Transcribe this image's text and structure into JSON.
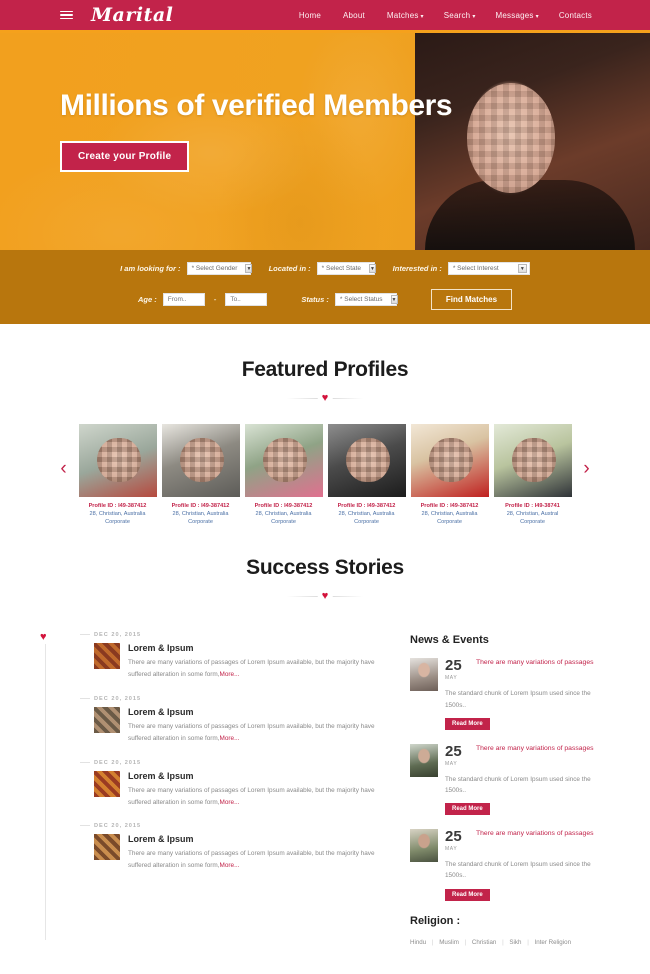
{
  "theme": {
    "brand_red": "#C2234A",
    "hero_orange": "#F2A01E",
    "filter_amber": "#B8760D",
    "heart_red": "#D3133C",
    "link_blue": "#4a6fa5"
  },
  "nav": {
    "brand": "Marital",
    "menu": [
      {
        "label": "Home",
        "caret": ""
      },
      {
        "label": "About",
        "caret": ""
      },
      {
        "label": "Matches",
        "caret": "▾"
      },
      {
        "label": "Search",
        "caret": "▾"
      },
      {
        "label": "Messages",
        "caret": "▾"
      },
      {
        "label": "Contacts",
        "caret": ""
      }
    ]
  },
  "hero": {
    "title": "Millions of verified Members",
    "cta": "Create your Profile"
  },
  "filters": {
    "looking_for_label": "I am looking for :",
    "looking_for_value": "* Select Gender",
    "located_in_label": "Located in :",
    "located_in_value": "* Select State",
    "interested_in_label": "Interested in :",
    "interested_in_value": "* Select Interest",
    "age_label": "Age :",
    "age_from_placeholder": "From..",
    "age_to_placeholder": "To..",
    "age_dash": "-",
    "status_label": "Status :",
    "status_value": "* Select Status",
    "find_button": "Find Matches"
  },
  "featured": {
    "title": "Featured Profiles",
    "prev_arrow": "‹",
    "next_arrow": "›",
    "heart": "♥",
    "cards": [
      {
        "id": "Profile ID : I49-387412",
        "desc": "28, Christian, Australia",
        "job": "Corporate"
      },
      {
        "id": "Profile ID : I49-387412",
        "desc": "28, Christian, Australia",
        "job": "Corporate"
      },
      {
        "id": "Profile ID : I49-387412",
        "desc": "28, Christian, Australia",
        "job": "Corporate"
      },
      {
        "id": "Profile ID : I49-387412",
        "desc": "28, Christian, Australia",
        "job": "Corporate"
      },
      {
        "id": "Profile ID : I49-387412",
        "desc": "28, Christian, Australia",
        "job": "Corporate"
      },
      {
        "id": "Profile ID : I49-38741",
        "desc": "28, Christian, Austral",
        "job": "Corporate"
      }
    ]
  },
  "success": {
    "title": "Success Stories",
    "heart": "♥",
    "stories": [
      {
        "date": "DEC 20, 2015",
        "name": "Lorem & Ipsum",
        "text": "There are many variations of passages of Lorem Ipsum available, but the majority have suffered alteration in some form,",
        "more": "More..."
      },
      {
        "date": "DEC 20, 2015",
        "name": "Lorem & Ipsum",
        "text": "There are many variations of passages of Lorem Ipsum available, but the majority have suffered alteration in some form,",
        "more": "More..."
      },
      {
        "date": "DEC 20, 2015",
        "name": "Lorem & Ipsum",
        "text": "There are many variations of passages of Lorem Ipsum available, but the majority have suffered alteration in some form,",
        "more": "More..."
      },
      {
        "date": "DEC 20, 2015",
        "name": "Lorem & Ipsum",
        "text": "There are many variations of passages of Lorem Ipsum available, but the majority have suffered alteration in some form,",
        "more": "More..."
      }
    ]
  },
  "news": {
    "title": "News & Events",
    "items": [
      {
        "day": "25",
        "month": "MAY",
        "headline": "There are many variations of passages",
        "body": "The standard chunk of Lorem Ipsum used since the 1500s..",
        "button": "Read More"
      },
      {
        "day": "25",
        "month": "MAY",
        "headline": "There are many variations of passages",
        "body": "The standard chunk of Lorem Ipsum used since the 1500s..",
        "button": "Read More"
      },
      {
        "day": "25",
        "month": "MAY",
        "headline": "There are many variations of passages",
        "body": "The standard chunk of Lorem Ipsum used since the 1500s..",
        "button": "Read More"
      }
    ]
  },
  "religion": {
    "title": "Religion :",
    "items": [
      "Hindu",
      "Muslim",
      "Christian",
      "Sikh",
      "Inter Religion"
    ],
    "separator": "|"
  }
}
